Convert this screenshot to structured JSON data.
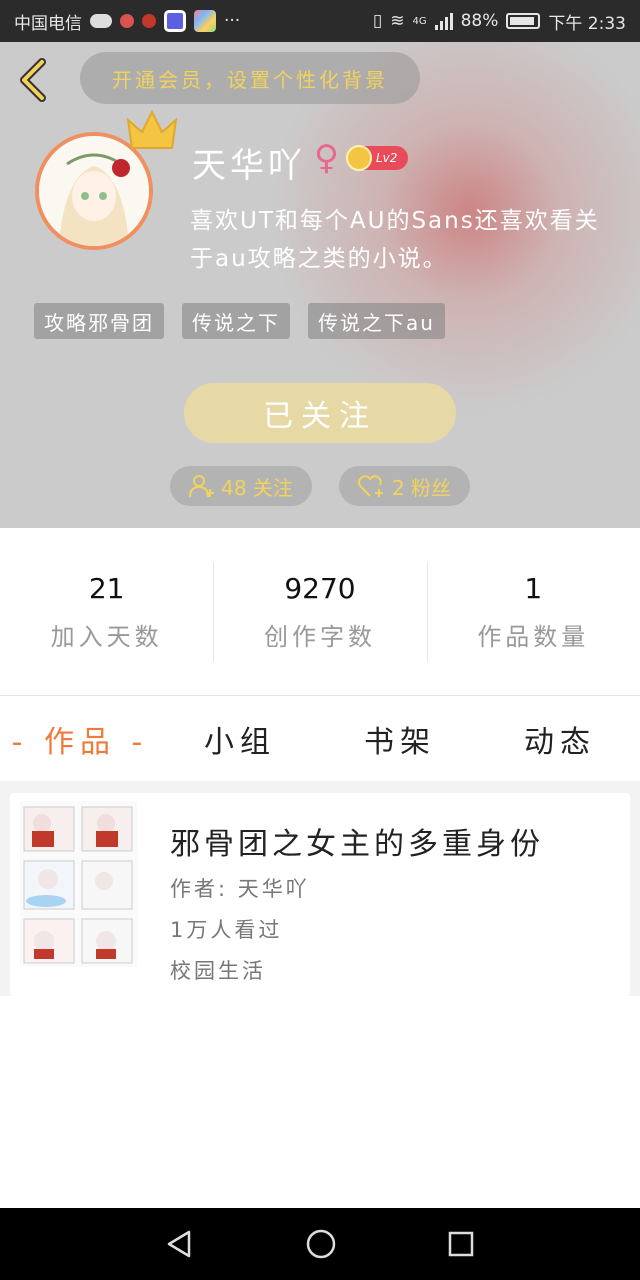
{
  "status_bar": {
    "carrier": "中国电信",
    "network": "4G",
    "battery": "88%",
    "time": "下午 2:33"
  },
  "header": {
    "vip_prompt": "开通会员，设置个性化背景",
    "username": "天华吖",
    "gender_symbol": "♀",
    "level": "Lv2",
    "bio": "喜欢UT和每个AU的Sans还喜欢看关于au攻略之类的小说。",
    "tags": [
      "攻略邪骨团",
      "传说之下",
      "传说之下au"
    ],
    "follow_button": "已关注",
    "following_label": "48 关注",
    "fans_label": "2 粉丝"
  },
  "stats": [
    {
      "value": "21",
      "label": "加入天数"
    },
    {
      "value": "9270",
      "label": "创作字数"
    },
    {
      "value": "1",
      "label": "作品数量"
    }
  ],
  "tabs": [
    "- 作品 -",
    "小组",
    "书架",
    "动态"
  ],
  "works": [
    {
      "title": "邪骨团之女主的多重身份",
      "author": "作者: 天华吖",
      "views": "1万人看过",
      "category": "校园生活"
    }
  ],
  "colors": {
    "accent": "#f07a3a",
    "gold": "#f2d35a",
    "follow_button": "#e6d9a5"
  }
}
